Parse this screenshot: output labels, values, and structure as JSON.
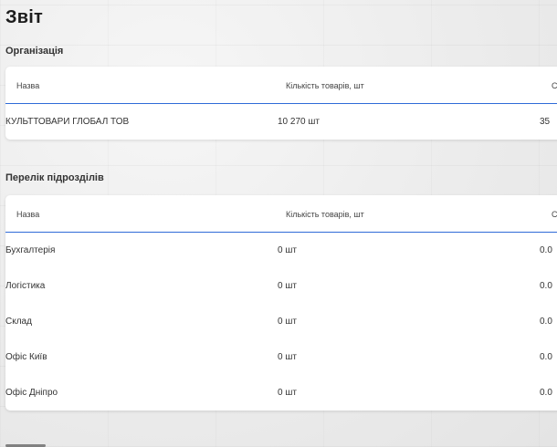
{
  "page": {
    "title": "Звіт"
  },
  "organization": {
    "title": "Організація",
    "columns": {
      "name": "Назва",
      "qty": "Кількість товарів, шт",
      "sum": "С"
    },
    "rows": [
      {
        "name": "КУЛЬТТОВАРИ ГЛОБАЛ ТОВ",
        "qty": "10 270 шт",
        "sum": "35"
      }
    ]
  },
  "departments": {
    "title": "Перелік підрозділів",
    "columns": {
      "name": "Назва",
      "qty": "Кількість товарів, шт",
      "sum": "С"
    },
    "rows": [
      {
        "name": "Бухгалтерія",
        "qty": "0 шт",
        "sum": "0.0"
      },
      {
        "name": "Логістика",
        "qty": "0 шт",
        "sum": "0.0"
      },
      {
        "name": "Склад",
        "qty": "0 шт",
        "sum": "0.0"
      },
      {
        "name": "Офіс Київ",
        "qty": "0 шт",
        "sum": "0.0"
      },
      {
        "name": "Офіс Дніпро",
        "qty": "0 шт",
        "sum": "0.0"
      }
    ]
  }
}
